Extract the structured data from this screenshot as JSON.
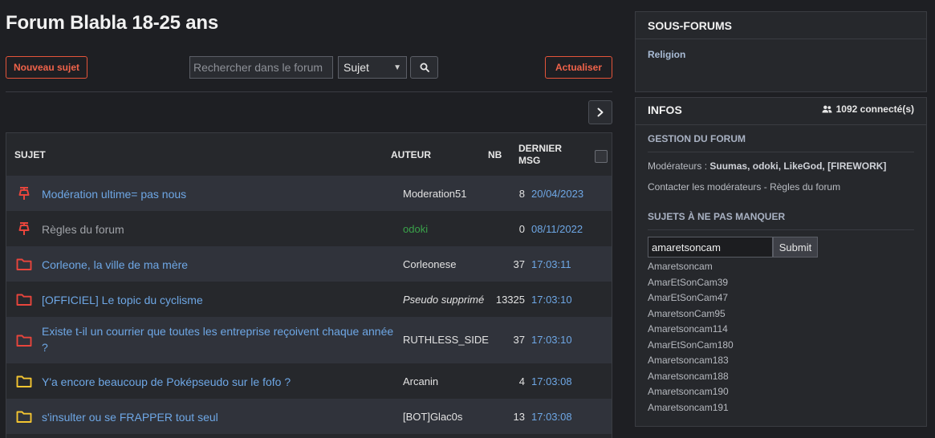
{
  "header": {
    "title": "Forum Blabla 18-25 ans",
    "new_topic_label": "Nouveau sujet",
    "refresh_label": "Actualiser"
  },
  "search": {
    "placeholder": "Rechercher dans le forum",
    "select_value": "Sujet"
  },
  "table": {
    "col_subject": "SUJET",
    "col_author": "AUTEUR",
    "col_nb": "NB",
    "col_last_line1": "DERNIER",
    "col_last_line2": "MSG",
    "rows": [
      {
        "icon": "pin-icon",
        "subject": "Modération ultime= pas nous",
        "author": "Moderation51",
        "nb": "8",
        "last": "20/04/2023"
      },
      {
        "icon": "pin-icon",
        "subject": "Règles du forum",
        "author": "odoki",
        "nb": "0",
        "last": "08/11/2022"
      },
      {
        "icon": "folder-red-icon",
        "subject": "Corleone, la ville de ma mère",
        "author": "Corleonese",
        "nb": "37",
        "last": "17:03:11"
      },
      {
        "icon": "folder-red-icon",
        "subject": "[OFFICIEL] Le topic du cyclisme",
        "author": "Pseudo supprimé",
        "nb": "13325",
        "last": "17:03:10"
      },
      {
        "icon": "folder-red-icon",
        "subject": "Existe t-il un courrier que toutes les entreprise reçoivent chaque année ?",
        "author": "RUTHLESS_SIDE",
        "nb": "37",
        "last": "17:03:10"
      },
      {
        "icon": "folder-yellow-icon",
        "subject": "Y'a encore beaucoup de Poképseudo sur le fofo ?",
        "author": "Arcanin",
        "nb": "4",
        "last": "17:03:08"
      },
      {
        "icon": "folder-yellow-icon",
        "subject": "s'insulter ou se FRAPPER tout seul",
        "author": "[BOT]Glac0s",
        "nb": "13",
        "last": "17:03:08"
      }
    ]
  },
  "sidebar": {
    "subforums_title": "SOUS-FORUMS",
    "subforum_link": "Religion",
    "info_title": "INFOS",
    "online_count": "1092 connecté(s)",
    "gestion_title": "GESTION DU FORUM",
    "moderators_label": "Modérateurs :",
    "moderators": "Suumas, odoki, LikeGod, [FIREWORK]",
    "contact_text": "Contacter les modérateurs - Règles du forum",
    "must_see_title": "SUJETS À NE PAS MANQUER",
    "input_value": "amaretsoncam",
    "submit_label": "Submit",
    "results": [
      "Amaretsoncam",
      "AmarEtSonCam39",
      "AmarEtSonCam47",
      "AmaretsonCam95",
      "Amaretsoncam114",
      "AmarEtSonCam180",
      "Amaretsoncam183",
      "Amaretsoncam188",
      "Amaretsoncam190",
      "Amaretsoncam191"
    ]
  },
  "colors": {
    "accent": "#f0634a",
    "link": "#6ea7e5",
    "pin": "#e8453c",
    "folder_red": "#e8453c",
    "folder_yellow": "#f4c531",
    "green_user": "#3aa24a"
  }
}
